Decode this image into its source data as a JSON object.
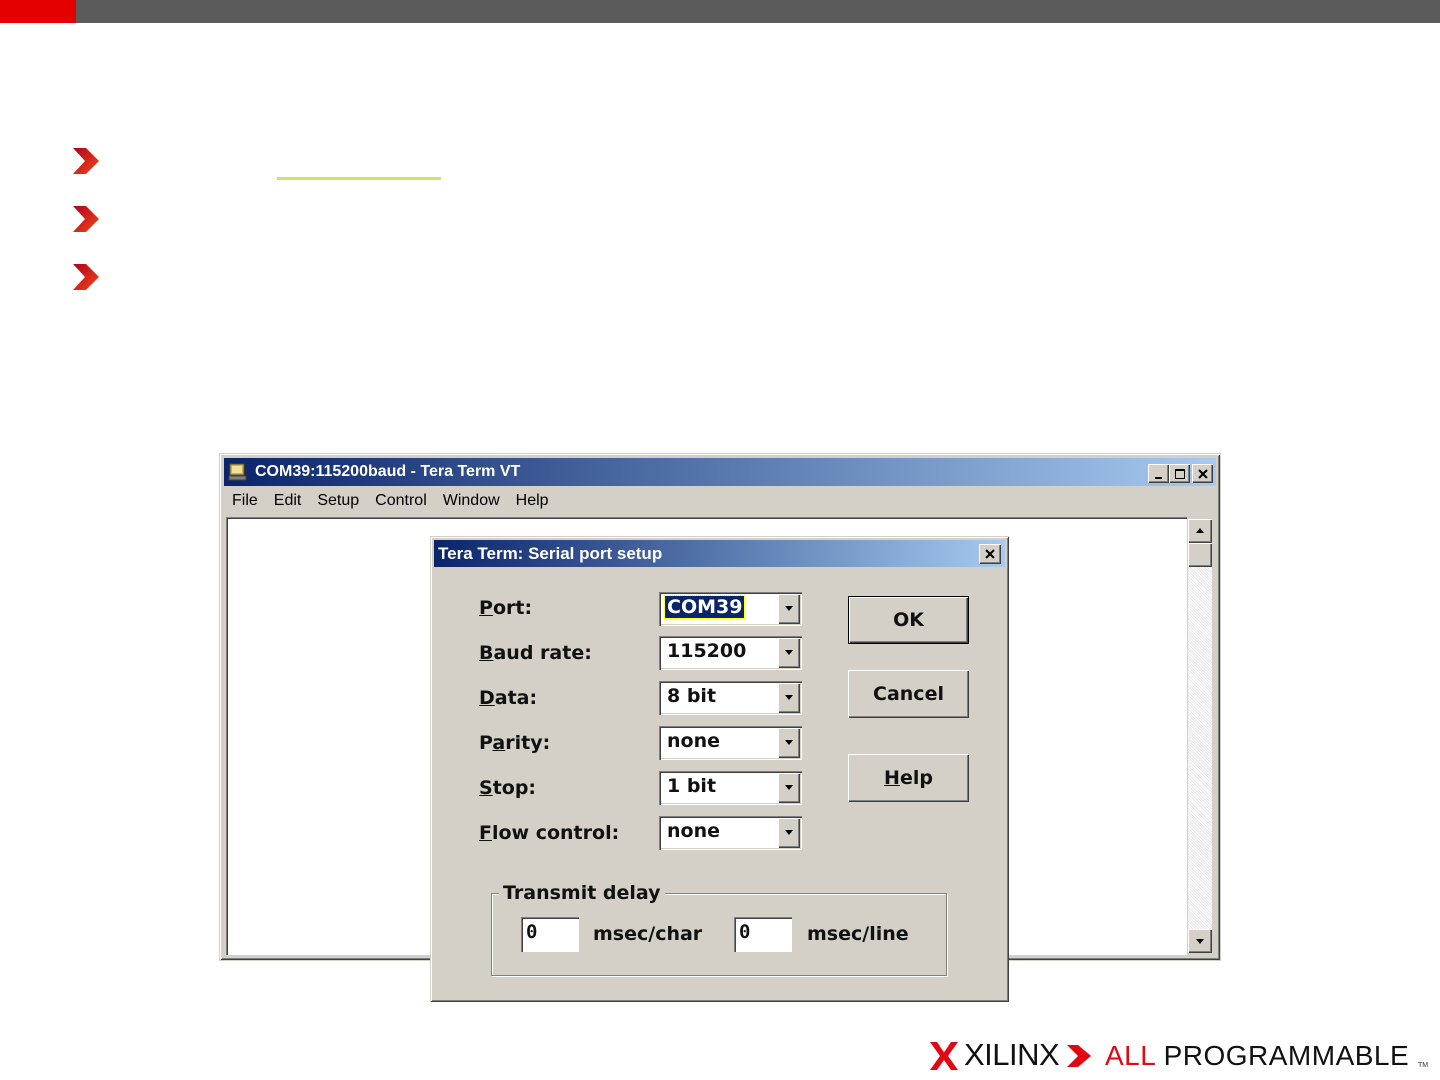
{
  "colors": {
    "accent_red": "#e40000",
    "topbar": "#5b5b5b",
    "title_blue": "#0a246a",
    "highlight_line": "#d7df66"
  },
  "main_window": {
    "title": "COM39:115200baud - Tera Term VT",
    "menu": [
      "File",
      "Edit",
      "Setup",
      "Control",
      "Window",
      "Help"
    ]
  },
  "dialog": {
    "title": "Tera Term: Serial port setup",
    "fields": [
      {
        "label": "Port:",
        "value": "COM39"
      },
      {
        "label": "Baud rate:",
        "value": "115200"
      },
      {
        "label": "Data:",
        "value": "8 bit"
      },
      {
        "label": "Parity:",
        "value": "none"
      },
      {
        "label": "Stop:",
        "value": "1 bit"
      },
      {
        "label": "Flow control:",
        "value": "none"
      }
    ],
    "buttons": {
      "ok": "OK",
      "cancel": "Cancel",
      "help": "Help"
    },
    "transmit_delay": {
      "label": "Transmit delay",
      "char_value": "0",
      "char_unit": "msec/char",
      "line_value": "0",
      "line_unit": "msec/line"
    }
  },
  "footer": {
    "brand": "XILINX",
    "tagline_red": "ALL",
    "tagline_rest": "PROGRAMMABLE",
    "tm": "TM"
  },
  "icons": [
    "bullet-chevron-icon",
    "app-icon",
    "minimize-icon",
    "maximize-icon",
    "close-icon",
    "dropdown-arrow-icon",
    "scroll-up-icon",
    "scroll-down-icon",
    "xilinx-logo-icon"
  ]
}
